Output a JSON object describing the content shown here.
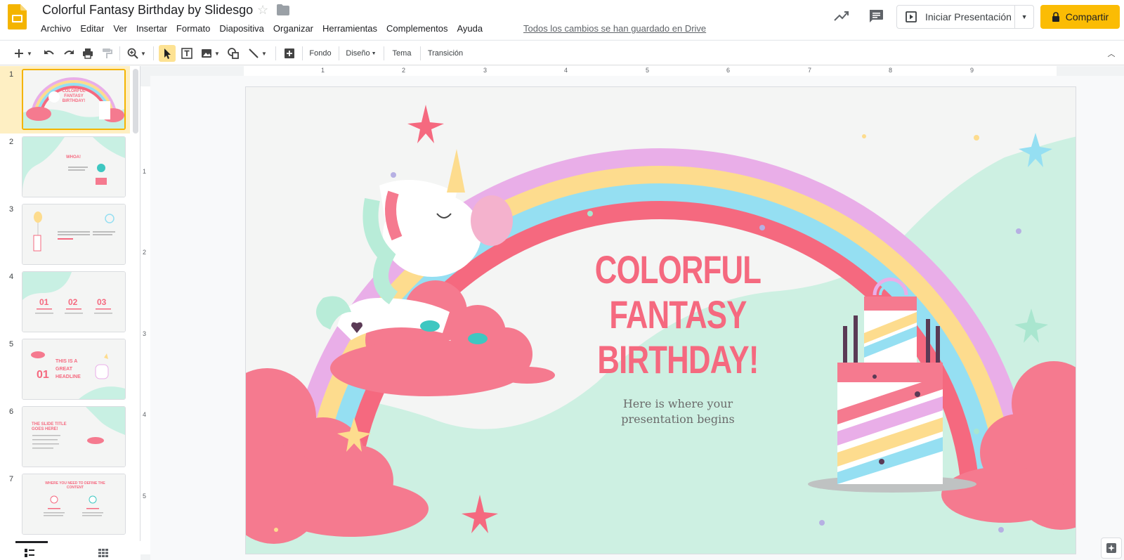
{
  "header": {
    "doc_title": "Colorful Fantasy Birthday by Slidesgo",
    "save_status": "Todos los cambios se han guardado en Drive",
    "present_label": "Iniciar Presentación",
    "share_label": "Compartir"
  },
  "menu": [
    "Archivo",
    "Editar",
    "Ver",
    "Insertar",
    "Formato",
    "Diapositiva",
    "Organizar",
    "Herramientas",
    "Complementos",
    "Ayuda"
  ],
  "toolbar": {
    "background_label": "Fondo",
    "layout_label": "Diseño",
    "theme_label": "Tema",
    "transition_label": "Transición"
  },
  "filmstrip": {
    "slide_numbers": [
      "1",
      "2",
      "3",
      "4",
      "5",
      "6",
      "7"
    ],
    "thumb_texts": {
      "t1": "COLORFUL FANTASY BIRTHDAY!",
      "t2": "WHOA!",
      "t4_a": "01",
      "t4_b": "02",
      "t4_c": "03",
      "t5_num": "01",
      "t5_head": "THIS IS A GREAT HEADLINE",
      "t6_head": "THE SLIDE TITLE GOES HERE!",
      "t7_head": "WHERE YOU NEED TO DEFINE THE CONTENT"
    }
  },
  "ruler": {
    "top": [
      "1",
      "2",
      "3",
      "4",
      "5",
      "6",
      "7",
      "8",
      "9"
    ],
    "left": [
      "1",
      "2",
      "3",
      "4",
      "5"
    ]
  },
  "slide": {
    "title": "COLORFUL\nFANTASY\nBIRTHDAY!",
    "subtitle": "Here is where your\npresentation begins"
  },
  "colors": {
    "accent_yellow": "#fbbc04",
    "slide_title_pink": "#f5697f",
    "mint": "#c8f0e3",
    "rainbow_violet": "#e9aee8",
    "rainbow_yellow": "#fddc8e",
    "rainbow_blue": "#95dff2",
    "rainbow_pink": "#f5697f"
  }
}
